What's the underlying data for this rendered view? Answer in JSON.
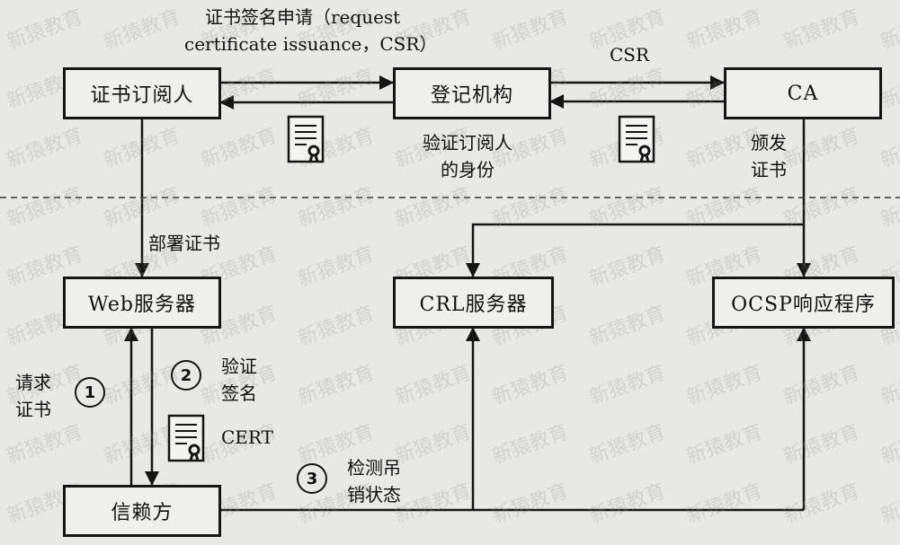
{
  "diagram": {
    "nodes": {
      "subscriber": "证书订阅人",
      "ra": "登记机构",
      "ca": "CA",
      "web_server": "Web服务器",
      "crl_server": "CRL服务器",
      "ocsp": "OCSP响应程序",
      "relying_party": "信赖方"
    },
    "labels": {
      "csr_request_line1": "证书签名申请（request",
      "csr_request_line2": "certificate issuance，CSR）",
      "csr": "CSR",
      "verify_identity_line1": "验证订阅人",
      "verify_identity_line2": "的身份",
      "issue_cert_line1": "颁发",
      "issue_cert_line2": "证书",
      "deploy_cert": "部署证书",
      "request_cert_line1": "请求",
      "request_cert_line2": "证书",
      "verify_sig_line1": "验证",
      "verify_sig_line2": "签名",
      "cert": "CERT",
      "check_revocation_line1": "检测吊",
      "check_revocation_line2": "销状态"
    },
    "steps": [
      "1",
      "2",
      "3"
    ],
    "watermark": "新猿教育"
  }
}
